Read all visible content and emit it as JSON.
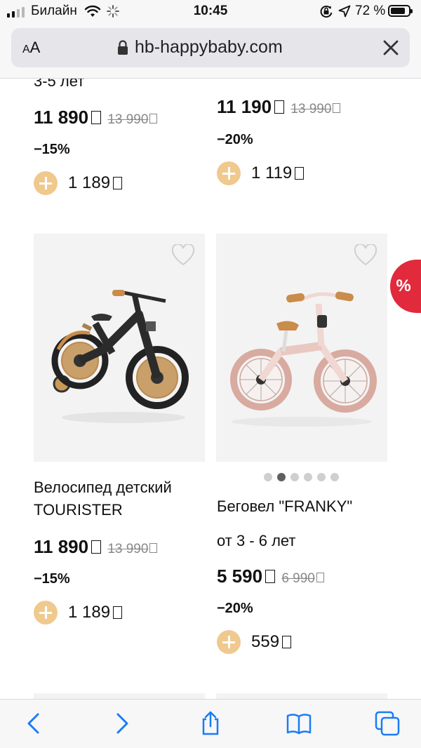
{
  "status_bar": {
    "carrier": "Билайн",
    "time": "10:45",
    "battery": "72 %"
  },
  "safari": {
    "text_size_label": "AA",
    "url": "hb-happybaby.com"
  },
  "products": [
    {
      "name": "3-5 лет",
      "price": "11 890",
      "old_price": "13 990",
      "discount": "−15%",
      "bonus": "1 189"
    },
    {
      "name": "",
      "price": "11 190",
      "old_price": "13 990",
      "discount": "−20%",
      "bonus": "1 119"
    },
    {
      "name_line1": "Велосипед детский",
      "name_line2": "TOURISTER",
      "price": "11 890",
      "old_price": "13 990",
      "discount": "−15%",
      "bonus": "1 189"
    },
    {
      "name_line1": "Беговел \"FRANKY\"",
      "name_line2": "от 3 - 6 лет",
      "price": "5 590",
      "old_price": "6 990",
      "discount": "−20%",
      "bonus": "559"
    }
  ],
  "gallery_dots": {
    "count": 6,
    "active_index": 1
  },
  "sale_badge": "%",
  "colors": {
    "bonus_accent": "#f0c98e",
    "sale_red": "#e12a3c",
    "ios_blue": "#1a7cf5"
  },
  "icons": [
    "wifi-icon",
    "loading-spinner-icon",
    "rotation-lock-icon",
    "location-icon",
    "battery-icon",
    "lock-icon",
    "close-icon",
    "heart-icon",
    "back-icon",
    "forward-icon",
    "share-icon",
    "bookmarks-icon",
    "tabs-icon"
  ]
}
